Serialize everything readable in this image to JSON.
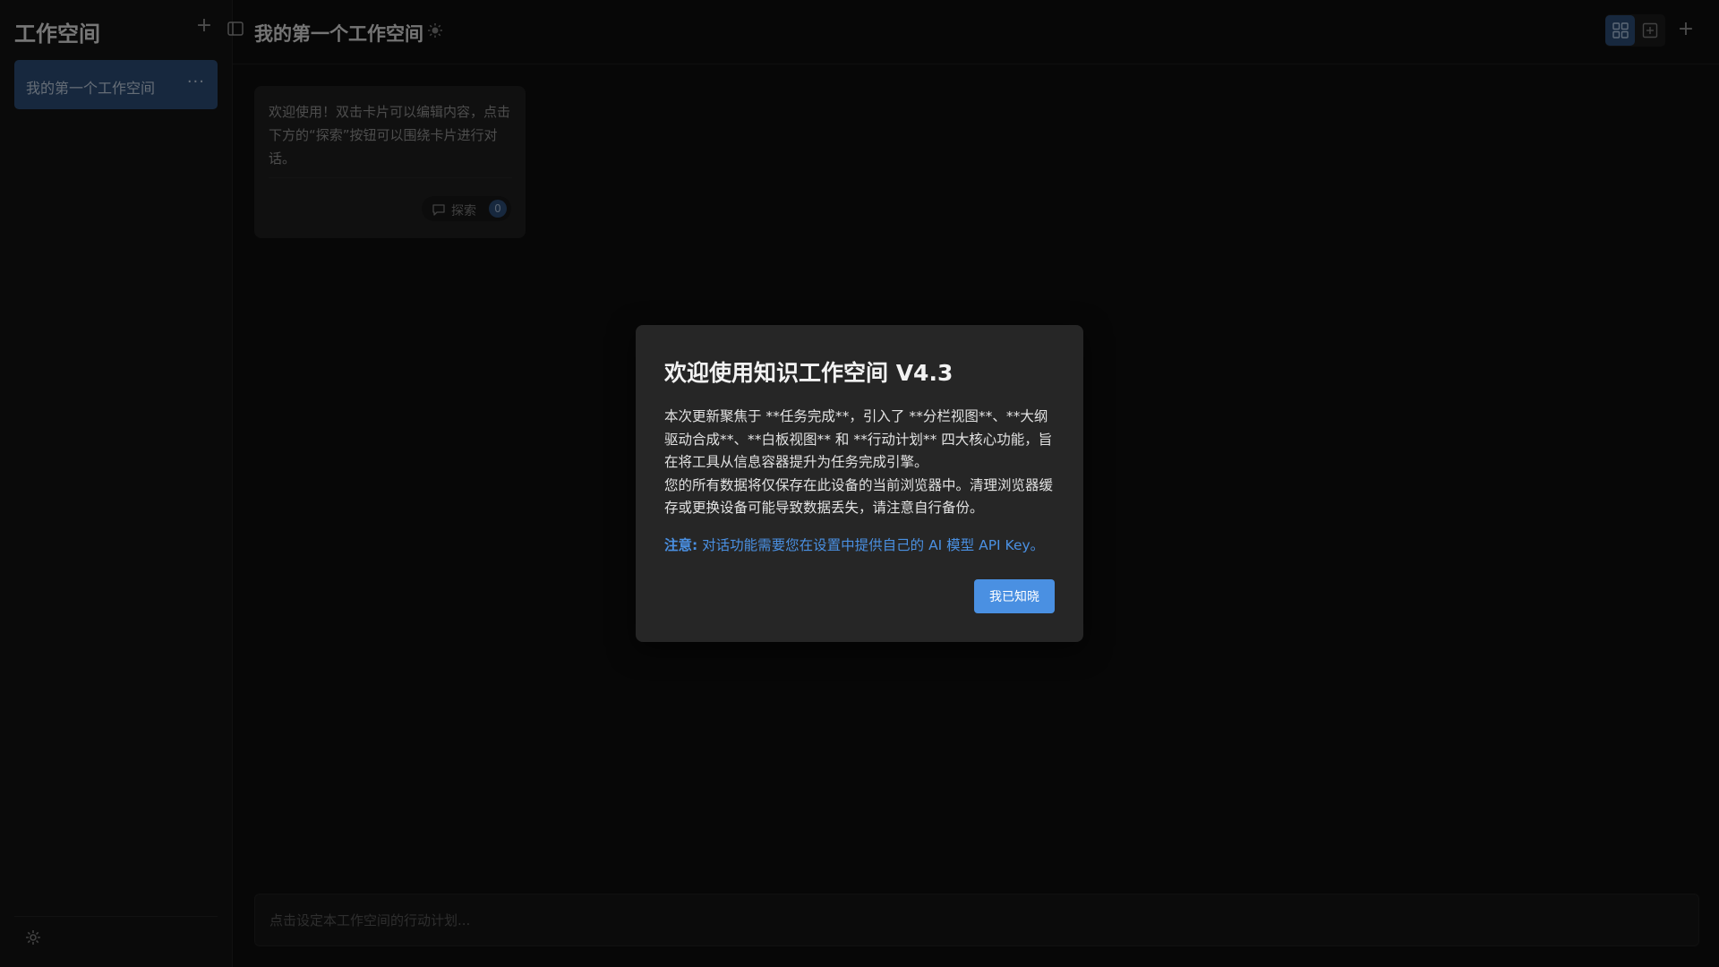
{
  "sidebar": {
    "title": "工作空间",
    "add_icon": "plus-icon",
    "workspaces": [
      {
        "label": "我的第一个工作空间",
        "more": "···",
        "active": true
      }
    ],
    "settings_icon": "gear-icon"
  },
  "header": {
    "toggle_icon": "sidebar-toggle-icon",
    "title": "我的第一个工作空间",
    "theme_icon": "sun-icon",
    "view_modes": [
      "grid-view-icon",
      "board-view-icon"
    ],
    "active_view": "grid",
    "add_icon": "plus-icon"
  },
  "cards": [
    {
      "text": "欢迎使用！双击卡片可以编辑内容，点击下方的“探索”按钮可以围绕卡片进行对话。",
      "explore_label": "探索",
      "explore_count": "0",
      "explore_icon": "chat-bubble-icon"
    }
  ],
  "action_plan": {
    "placeholder": "点击设定本工作空间的行动计划..."
  },
  "modal": {
    "title": "欢迎使用知识工作空间 V4.3",
    "body_line1": "本次更新聚焦于 **任务完成**，引入了 **分栏视图**、**大纲驱动合成**、**白板视图** 和 **行动计划** 四大核心功能，旨在将工具从信息容器提升为任务完成引擎。",
    "body_line2": "您的所有数据将仅保存在此设备的当前浏览器中。清理浏览器缓存或更换设备可能导致数据丢失，请注意自行备份。",
    "note_label": "注意:",
    "note_text": "对话功能需要您在设置中提供自己的 AI 模型 API Key。",
    "ok_label": "我已知晓"
  },
  "colors": {
    "accent": "#4a90e2",
    "active_item": "#2b4a72",
    "background": "#0d0d0d",
    "modal_bg": "#262626"
  }
}
